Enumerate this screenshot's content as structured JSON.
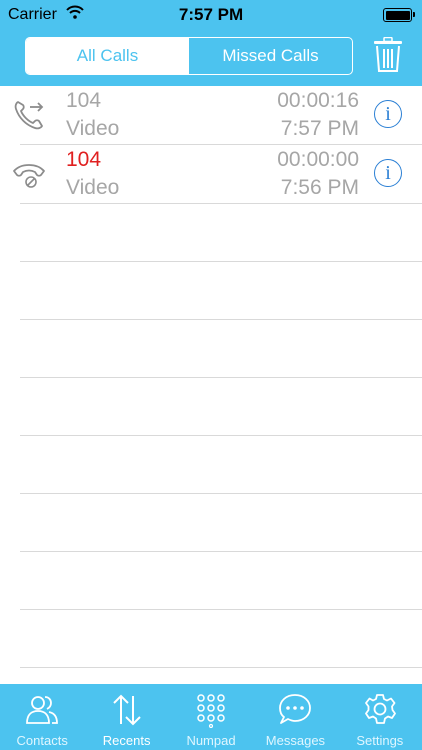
{
  "status_bar": {
    "carrier": "Carrier",
    "time": "7:57 PM"
  },
  "segmented": {
    "all_calls": "All Calls",
    "missed_calls": "Missed Calls",
    "selected": "All Calls"
  },
  "calls": [
    {
      "number": "104",
      "media": "Video",
      "duration": "00:00:16",
      "time": "7:57 PM",
      "type": "outgoing",
      "icon": "outgoing-call-icon"
    },
    {
      "number": "104",
      "media": "Video",
      "duration": "00:00:00",
      "time": "7:56 PM",
      "type": "missed",
      "icon": "missed-call-icon"
    }
  ],
  "tabs": [
    {
      "label": "Contacts",
      "icon": "contacts-icon"
    },
    {
      "label": "Recents",
      "icon": "recents-icon",
      "active": true
    },
    {
      "label": "Numpad",
      "icon": "numpad-icon"
    },
    {
      "label": "Messages",
      "icon": "messages-icon"
    },
    {
      "label": "Settings",
      "icon": "settings-icon"
    }
  ],
  "colors": {
    "header": "#4cc3ef",
    "missed": "#e02020",
    "info": "#2a7fd4",
    "muted_text": "#a6a6a6"
  }
}
